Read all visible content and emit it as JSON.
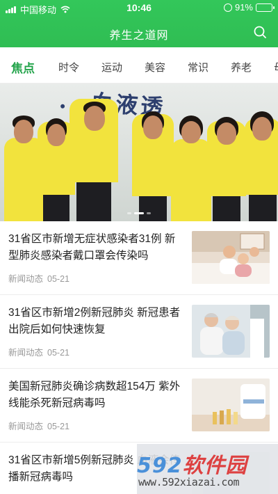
{
  "status_bar": {
    "carrier": "中国移动",
    "time": "10:46",
    "battery_percent": "91%",
    "battery_level": 0.91
  },
  "header": {
    "title": "养生之道网",
    "search_icon": "search-icon"
  },
  "tabs": [
    {
      "label": "焦点",
      "active": true
    },
    {
      "label": "时令",
      "active": false
    },
    {
      "label": "运动",
      "active": false
    },
    {
      "label": "美容",
      "active": false
    },
    {
      "label": "常识",
      "active": false
    },
    {
      "label": "养老",
      "active": false
    },
    {
      "label": "母",
      "active": false
    }
  ],
  "banner": {
    "sign_text": "...血液透",
    "active_slide": 1,
    "slide_count": 3
  },
  "news": [
    {
      "title": "31省区市新增无症状感染者31例 新型肺炎感染者戴口罩会传染吗",
      "source": "新闻动态",
      "date": "05-21"
    },
    {
      "title": "31省区市新增2例新冠肺炎 新冠患者出院后如何快速恢复",
      "source": "新闻动态",
      "date": "05-21"
    },
    {
      "title": "美国新冠肺炎确诊病数超154万 紫外线能杀死新冠病毒吗",
      "source": "新闻动态",
      "date": "05-21"
    },
    {
      "title": "31省区市新增5例新冠肺炎 血液会传播新冠病毒吗",
      "source": "",
      "date": ""
    }
  ],
  "watermark": {
    "number": "592",
    "text": "软件园",
    "url": "www.592xiazai.com"
  },
  "colors": {
    "brand_green": "#2fbd53",
    "tab_active": "#22a34a"
  }
}
